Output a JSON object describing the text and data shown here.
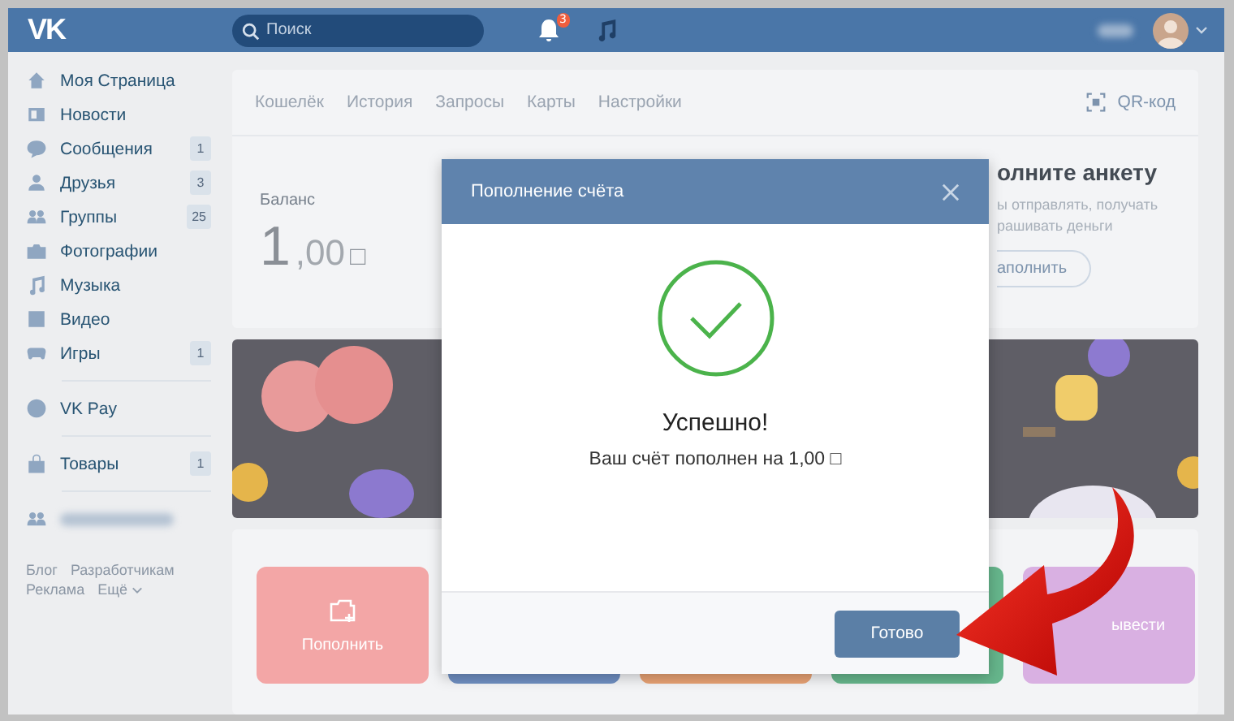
{
  "header": {
    "logo": "VK",
    "search": {
      "placeholder": "Поиск"
    },
    "notifications": {
      "count": "3"
    }
  },
  "sidebar": {
    "sections": [
      [
        {
          "label": "Моя Страница"
        },
        {
          "label": "Новости"
        },
        {
          "label": "Сообщения",
          "count": "1"
        },
        {
          "label": "Друзья",
          "count": "3"
        },
        {
          "label": "Группы",
          "count": "25"
        },
        {
          "label": "Фотографии"
        },
        {
          "label": "Музыка"
        },
        {
          "label": "Видео"
        },
        {
          "label": "Игры",
          "count": "1"
        }
      ],
      [
        {
          "label": "VK Pay"
        }
      ],
      [
        {
          "label": "Товары",
          "count": "1"
        }
      ],
      [
        {
          "kind": "blurred"
        }
      ]
    ],
    "footer_links": [
      "Блог",
      "Разработчикам",
      "Реклама",
      "Ещё"
    ]
  },
  "wallet": {
    "tabs": [
      "Кошелёк",
      "История",
      "Запросы",
      "Карты",
      "Настройки"
    ],
    "qr": "QR-код",
    "balance": {
      "label": "Баланс",
      "integer": "1",
      "fraction": ",00",
      "currency": "□"
    },
    "promo": {
      "title": "олните анкету",
      "lines": [
        "ы отправлять, получать",
        "рашивать деньги"
      ],
      "button": "аполнить"
    },
    "actions": [
      {
        "label": "Пополнить",
        "color": "#f3a6a6"
      },
      {
        "color": "#6f8fc2"
      },
      {
        "color": "#e8a274"
      },
      {
        "color": "#66b68c"
      },
      {
        "label": "ывести",
        "color": "#d9b0e2"
      }
    ]
  },
  "modal": {
    "title": "Пополнение счёта",
    "heading": "Успешно!",
    "message": "Ваш счёт пополнен на 1,00 □",
    "button": "Готово"
  }
}
